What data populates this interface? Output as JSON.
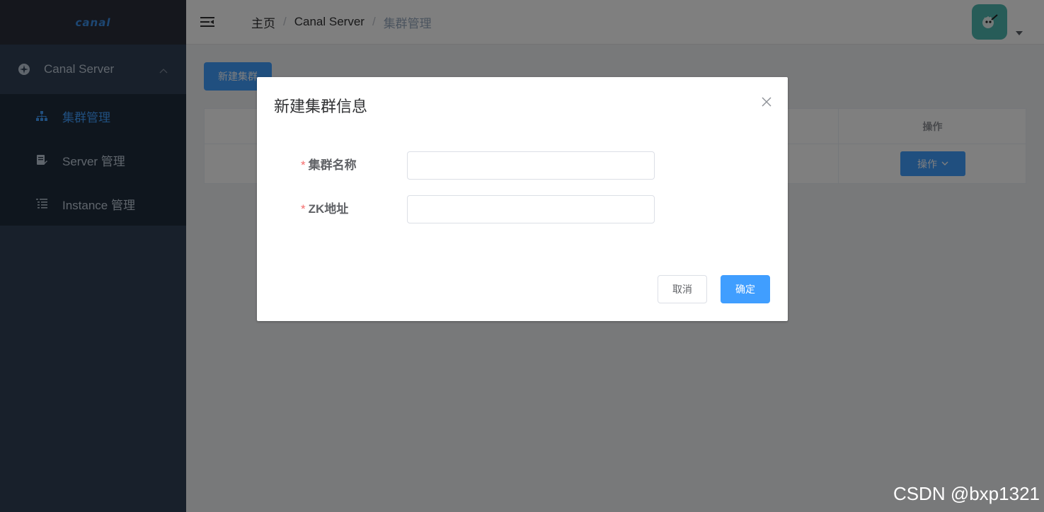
{
  "app": {
    "logo": "canal"
  },
  "sidebar": {
    "group_label": "Canal Server",
    "items": [
      {
        "label": "集群管理",
        "icon": "sitemap-icon",
        "active": true
      },
      {
        "label": "Server 管理",
        "icon": "edit-document-icon",
        "active": false
      },
      {
        "label": "Instance 管理",
        "icon": "list-icon",
        "active": false
      }
    ]
  },
  "header": {
    "breadcrumb": [
      "主页",
      "Canal Server",
      "集群管理"
    ],
    "breadcrumb_separator": "/"
  },
  "main": {
    "new_button_label": "新建集群",
    "table": {
      "op_header": "操作",
      "op_button_label": "操作"
    }
  },
  "dialog": {
    "title": "新建集群信息",
    "fields": [
      {
        "label": "集群名称",
        "required_mark": "*",
        "value": "",
        "placeholder": ""
      },
      {
        "label": "ZK地址",
        "required_mark": "*",
        "value": "",
        "placeholder": ""
      }
    ],
    "cancel_label": "取消",
    "confirm_label": "确定"
  },
  "watermark": "CSDN @bxp1321",
  "colors": {
    "sidebar_bg": "#304156",
    "submenu_bg": "#1f2d3d",
    "primary": "#409eff",
    "required": "#f56c6c"
  }
}
